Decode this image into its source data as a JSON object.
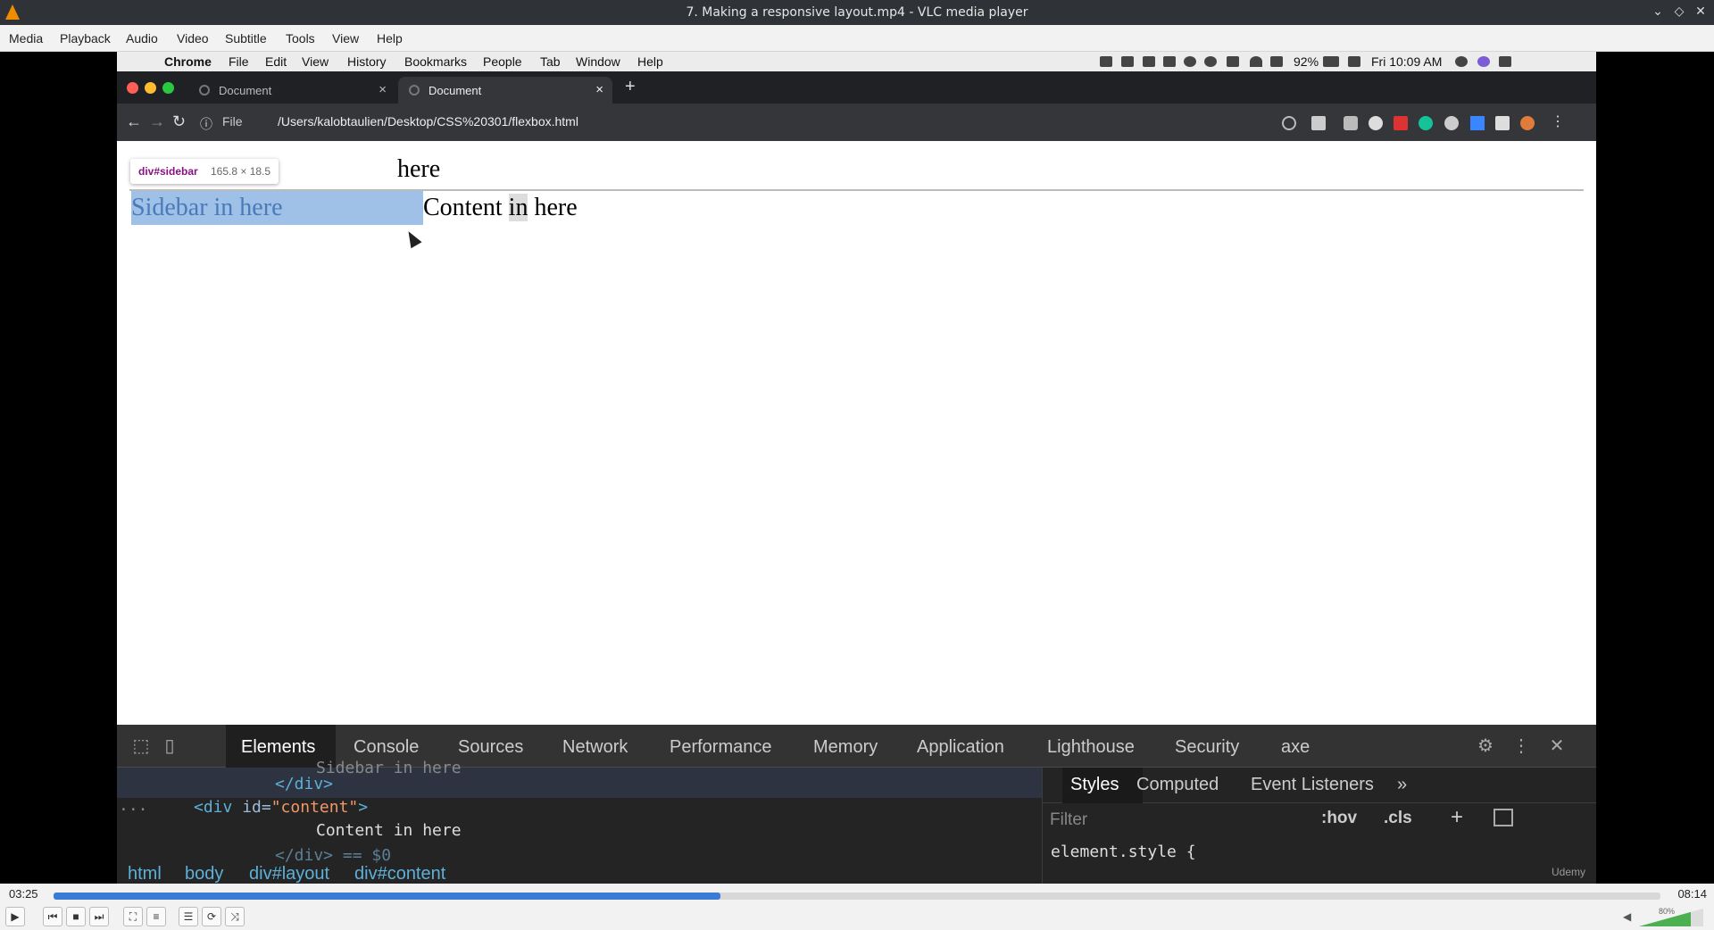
{
  "window": {
    "title": "7. Making a responsive layout.mp4 - VLC media player"
  },
  "menu": [
    "Media",
    "Playback",
    "Audio",
    "Video",
    "Subtitle",
    "Tools",
    "View",
    "Help"
  ],
  "mac_menubar": {
    "app": "Chrome",
    "items": [
      "File",
      "Edit",
      "View",
      "History",
      "Bookmarks",
      "People",
      "Tab",
      "Window",
      "Help"
    ],
    "battery": "92%",
    "clock": "Fri 10:09 AM"
  },
  "browser": {
    "tabs": [
      {
        "label": "Document",
        "active": false
      },
      {
        "label": "Document",
        "active": true
      }
    ],
    "url_prefix": "File",
    "url": "/Users/kalobtaulien/Desktop/CSS%20301/flexbox.html"
  },
  "page": {
    "header_visible": "here",
    "sidebar_text": "Sidebar in here",
    "content_before": "Content ",
    "content_highlight": "in",
    "content_after": " here",
    "tooltip_selector": "div#sidebar",
    "tooltip_size": "165.8 × 18.5"
  },
  "devtools": {
    "tabs": [
      "Elements",
      "Console",
      "Sources",
      "Network",
      "Performance",
      "Memory",
      "Application",
      "Lighthouse",
      "Security",
      "axe"
    ],
    "active_tab": "Elements",
    "dom": {
      "partial_text": "Sidebar in here",
      "close_div": "</div>",
      "ellipsis": "...",
      "open_div_tag": "<div",
      "open_div_attr": " id=",
      "open_div_val": "\"content\"",
      "open_div_end": ">",
      "content_text": "Content in here",
      "partial_close": "</div> == $0"
    },
    "breadcrumb": [
      "html",
      "body",
      "div#layout",
      "div#content"
    ],
    "styles_tabs": [
      "Styles",
      "Computed",
      "Event Listeners"
    ],
    "more": "»",
    "filter_placeholder": "Filter",
    "hov": ":hov",
    "cls": ".cls",
    "element_style": "element.style {",
    "watermark": "Udemy"
  },
  "player": {
    "elapsed": "03:25",
    "total": "08:14",
    "progress": 0.415,
    "volume": "80%",
    "volume_level": 0.8
  }
}
